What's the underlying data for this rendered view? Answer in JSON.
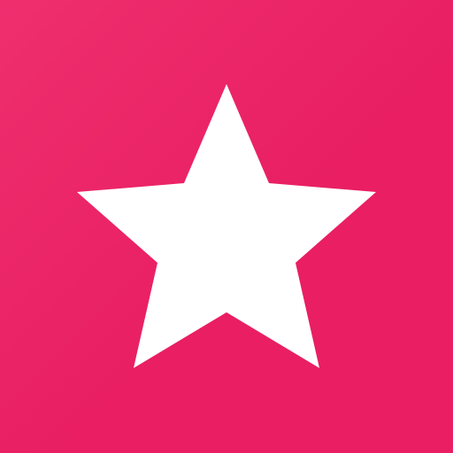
{
  "app_icon": {
    "icon": "star-icon",
    "colors": {
      "background": "#E91E63",
      "background_highlight": "#EE2F6E",
      "glyph": "#FFFFFF"
    }
  }
}
